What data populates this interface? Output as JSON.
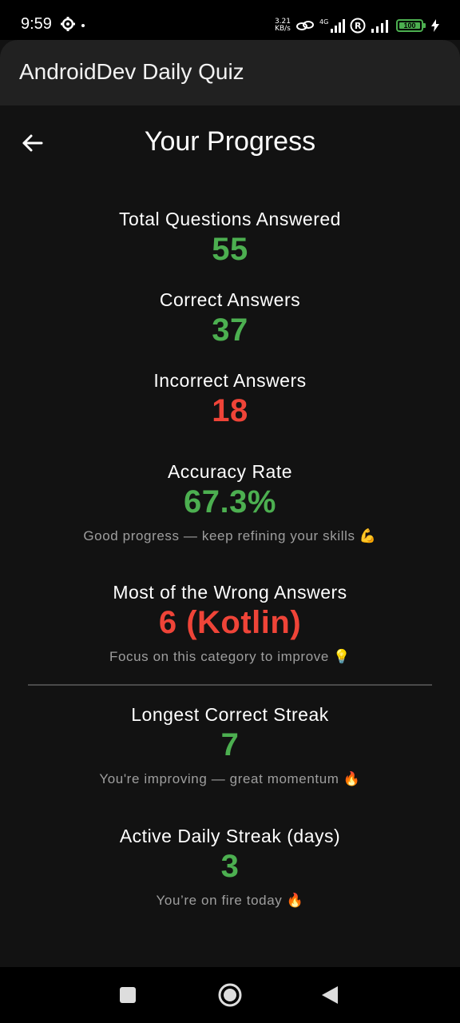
{
  "status_bar": {
    "time": "9:59",
    "net_speed_value": "3.21",
    "net_speed_unit": "KB/s",
    "network_type": "4G",
    "battery_level": "100",
    "icons": [
      "gear-icon",
      "dot-icon",
      "link-icon",
      "signal-icon",
      "roaming-icon",
      "signal-icon",
      "battery-icon",
      "charging-icon"
    ]
  },
  "app_bar": {
    "title": "AndroidDev Daily Quiz"
  },
  "header": {
    "title": "Your Progress",
    "back_icon": "arrow-left-icon"
  },
  "stats": [
    {
      "label": "Total Questions Answered",
      "value": "55"
    },
    {
      "label": "Correct Answers",
      "value": "37"
    },
    {
      "label": "Incorrect Answers",
      "value": "18"
    },
    {
      "label": "Accuracy Rate",
      "value": "67.3%",
      "note": "Good progress — keep refining your skills 💪"
    },
    {
      "label": "Most of the Wrong Answers",
      "value": "6 (Kotlin)",
      "note": "Focus on this category to improve 💡"
    },
    {
      "label": "Longest Correct Streak",
      "value": "7",
      "note": "You're improving — great momentum 🔥"
    },
    {
      "label": "Active Daily Streak (days)",
      "value": "3",
      "note": "You’re on fire today 🔥"
    }
  ],
  "colors": {
    "positive": "#4caf50",
    "negative": "#ef4438",
    "background": "#121212",
    "app_bar": "#212121"
  },
  "nav_bar": {
    "icons": [
      "recents-square-icon",
      "home-circle-icon",
      "back-triangle-icon"
    ]
  }
}
